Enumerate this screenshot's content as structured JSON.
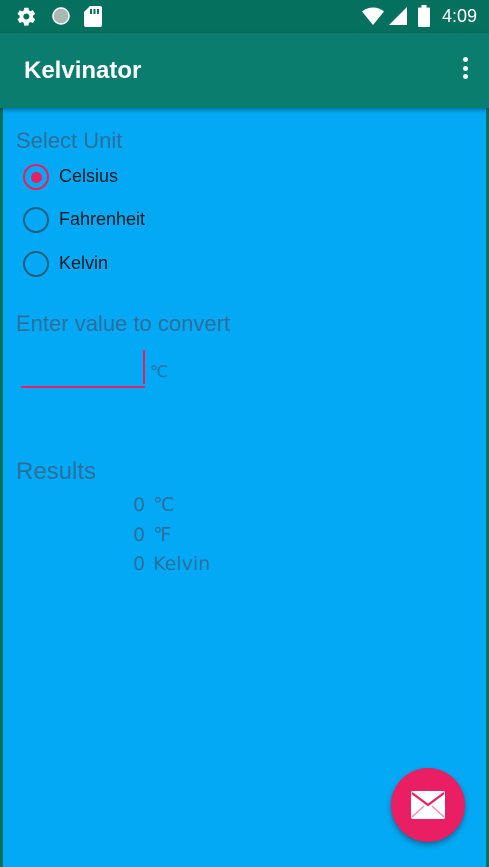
{
  "status_bar": {
    "time": "4:09",
    "left_icons": [
      "gear-icon",
      "circle-icon",
      "sd-card-icon"
    ],
    "right_icons": [
      "wifi-icon",
      "signal-icon",
      "battery-icon"
    ]
  },
  "app_bar": {
    "title": "Kelvinator",
    "menu_icon": "overflow-menu-icon"
  },
  "unit_section": {
    "label": "Select Unit",
    "options": [
      {
        "label": "Celsius",
        "checked": true
      },
      {
        "label": "Fahrenheit",
        "checked": false
      },
      {
        "label": "Kelvin",
        "checked": false
      }
    ]
  },
  "convert_section": {
    "label": "Enter value to convert",
    "input_value": "",
    "unit": "℃"
  },
  "results_section": {
    "label": "Results",
    "rows": [
      {
        "value": "0",
        "unit": "℃"
      },
      {
        "value": "0",
        "unit": "℉"
      },
      {
        "value": "0",
        "unit": "Kelvin"
      }
    ]
  },
  "fab": {
    "icon": "email-icon"
  },
  "colors": {
    "status_bar": "#06705e",
    "app_bar": "#0b7d6e",
    "background": "#03a9f4",
    "accent": "#e91e63",
    "label_text": "#2a6f9e"
  }
}
